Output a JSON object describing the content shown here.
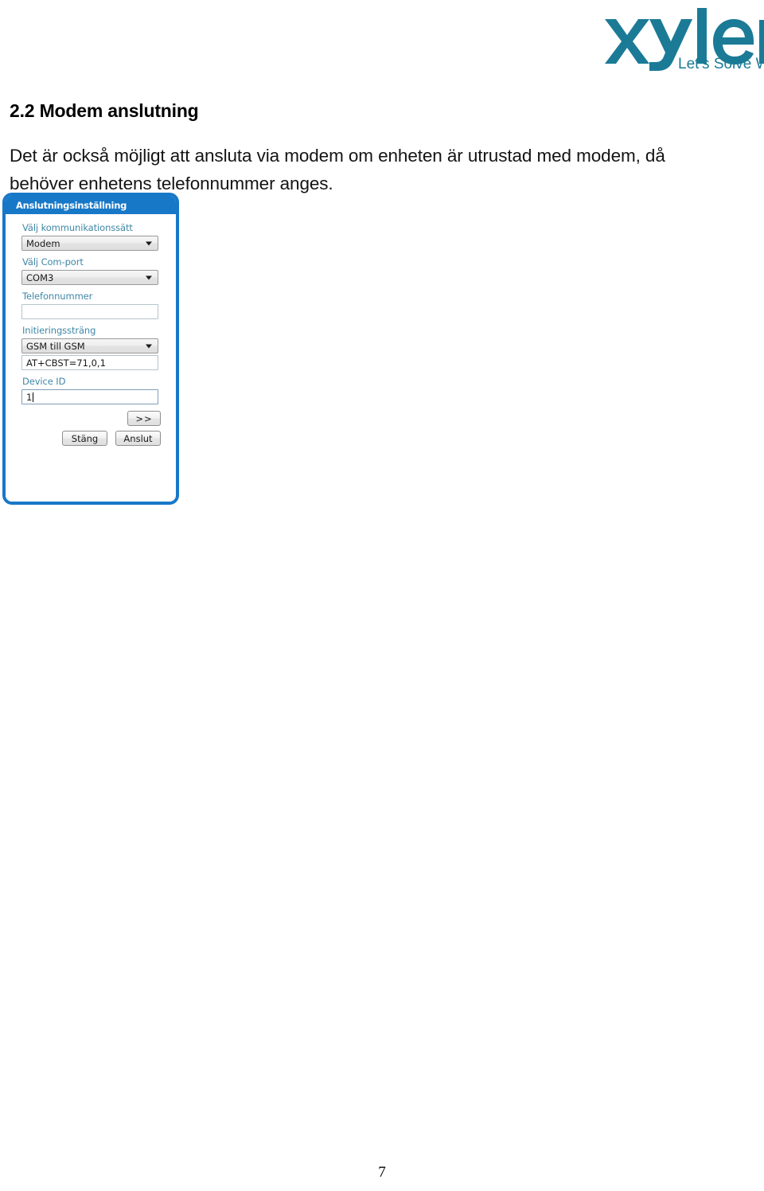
{
  "logo": {
    "wordmark": "xylem",
    "tagline": "Let's Solve Water",
    "brand_color": "#1b7b96"
  },
  "heading": "2.2 Modem anslutning",
  "body_text": "Det är också möjligt att ansluta via modem om enheten är utrustad med modem, då behöver enhetens telefonnummer anges.",
  "dialog": {
    "title": "Anslutningsinställning",
    "title_bar_color": "#1878c8",
    "border_color": "#1878c8",
    "label_color": "#3f87a6",
    "fields": [
      {
        "label": "Välj kommunikationssätt",
        "type": "combo",
        "value": "Modem"
      },
      {
        "label": "Välj Com-port",
        "type": "combo",
        "value": "COM3"
      },
      {
        "label": "Telefonnummer",
        "type": "textbox",
        "value": ""
      },
      {
        "label": "Initieringssträng",
        "type": "combo",
        "value": "GSM till GSM"
      },
      {
        "label": "",
        "type": "textbox",
        "value": "AT+CBST=71,0,1"
      },
      {
        "label": "Device ID",
        "type": "textbox",
        "value": "1"
      }
    ],
    "buttons": {
      "next": ">>",
      "close": "Stäng",
      "connect": "Anslut"
    }
  },
  "page_number": "7"
}
